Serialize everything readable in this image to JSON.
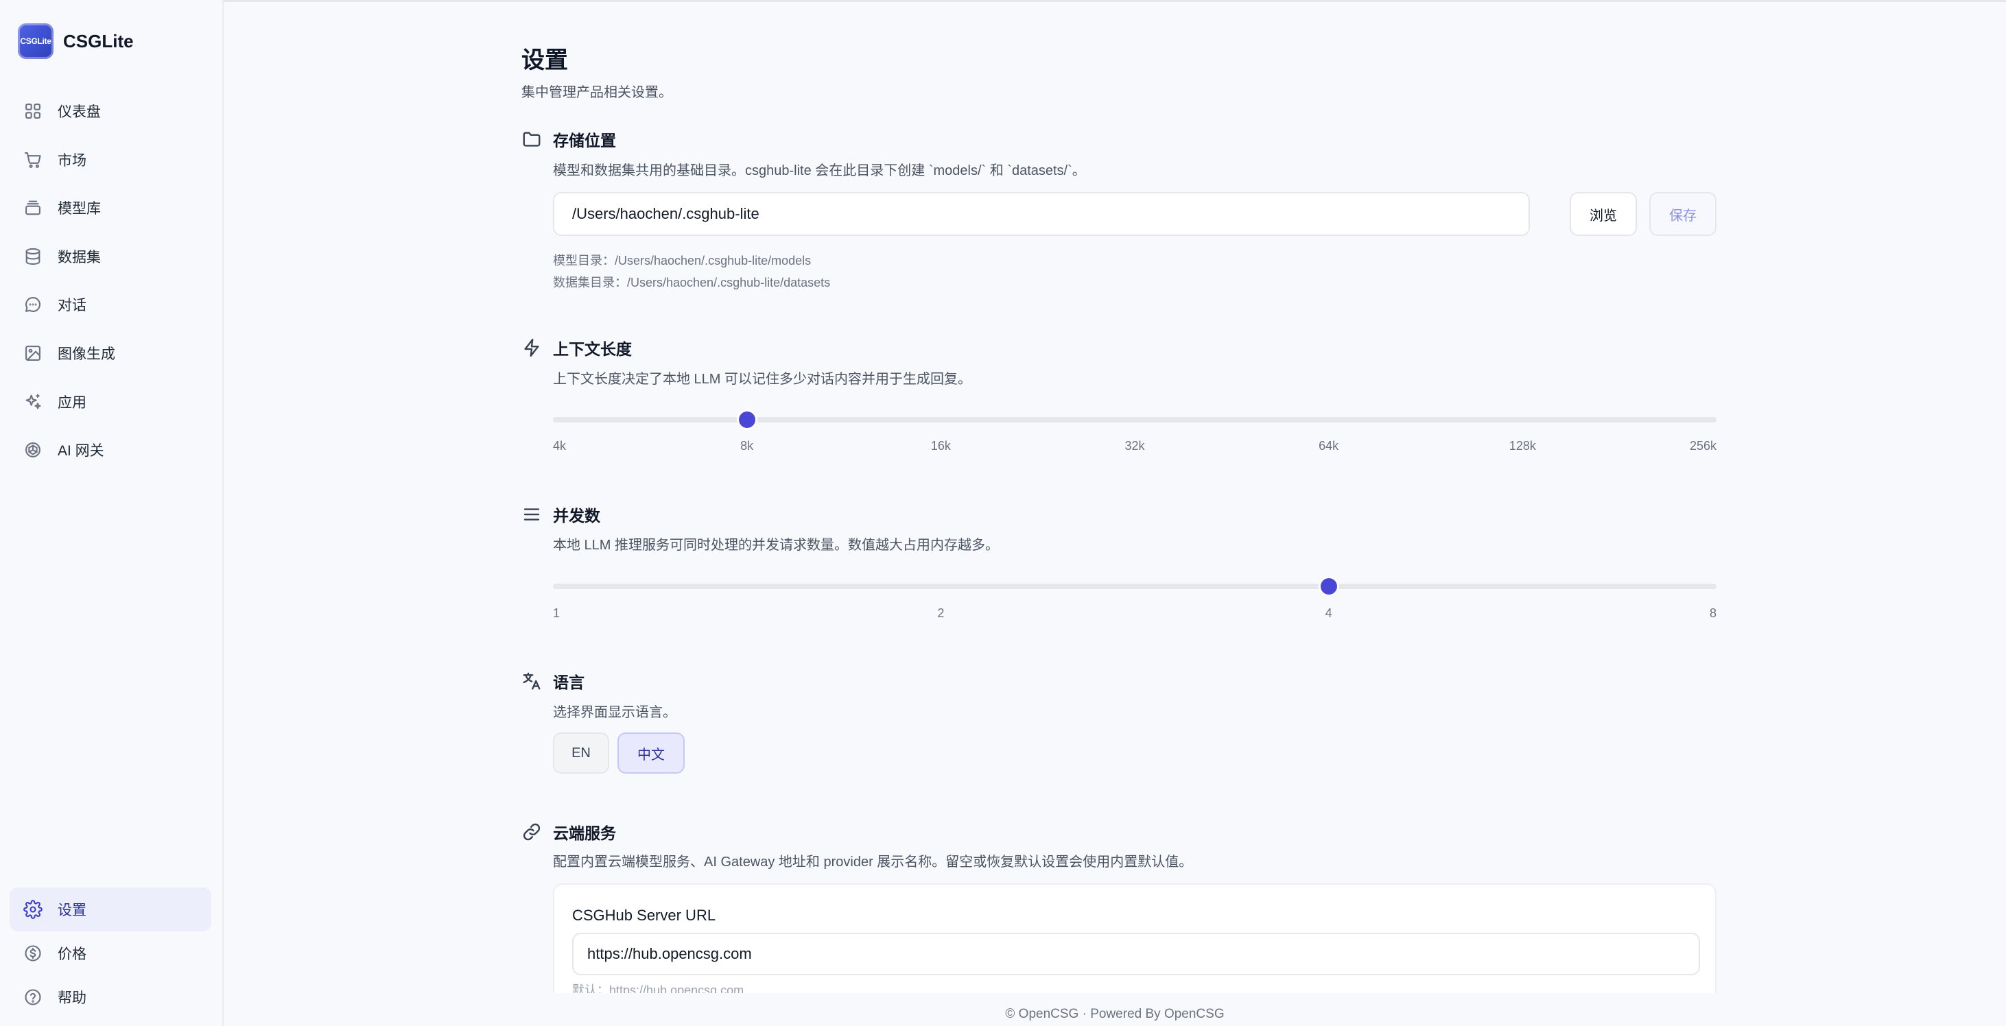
{
  "app": {
    "name": "CSGLite",
    "logo_text": "CSGLite"
  },
  "sidebar": {
    "items": [
      {
        "label": "仪表盘",
        "icon": "grid-icon"
      },
      {
        "label": "市场",
        "icon": "cart-icon"
      },
      {
        "label": "模型库",
        "icon": "layers-icon"
      },
      {
        "label": "数据集",
        "icon": "database-icon"
      },
      {
        "label": "对话",
        "icon": "chat-icon"
      },
      {
        "label": "图像生成",
        "icon": "image-icon"
      },
      {
        "label": "应用",
        "icon": "sparkles-icon"
      },
      {
        "label": "AI 网关",
        "icon": "openai-icon"
      }
    ],
    "bottom_items": [
      {
        "label": "设置",
        "icon": "gear-icon",
        "active": true
      },
      {
        "label": "价格",
        "icon": "dollar-icon"
      },
      {
        "label": "帮助",
        "icon": "help-icon"
      }
    ]
  },
  "page": {
    "title": "设置",
    "subtitle": "集中管理产品相关设置。"
  },
  "storage": {
    "title": "存储位置",
    "desc": "模型和数据集共用的基础目录。csghub-lite 会在此目录下创建 `models/` 和 `datasets/`。",
    "path_value": "/Users/haochen/.csghub-lite",
    "browse_label": "浏览",
    "save_label": "保存",
    "models_dir": "模型目录：/Users/haochen/.csghub-lite/models",
    "datasets_dir": "数据集目录：/Users/haochen/.csghub-lite/datasets"
  },
  "context": {
    "title": "上下文长度",
    "desc": "上下文长度决定了本地 LLM 可以记住多少对话内容并用于生成回复。",
    "ticks": [
      "4k",
      "8k",
      "16k",
      "32k",
      "64k",
      "128k",
      "256k"
    ],
    "value": "8k",
    "value_index": 1
  },
  "concurrency": {
    "title": "并发数",
    "desc": "本地 LLM 推理服务可同时处理的并发请求数量。数值越大占用内存越多。",
    "ticks": [
      "1",
      "2",
      "4",
      "8"
    ],
    "value": "4",
    "value_index": 2
  },
  "language": {
    "title": "语言",
    "desc": "选择界面显示语言。",
    "options": [
      "EN",
      "中文"
    ],
    "selected": "中文"
  },
  "cloud": {
    "title": "云端服务",
    "desc": "配置内置云端模型服务、AI Gateway 地址和 provider 展示名称。留空或恢复默认设置会使用内置默认值。",
    "server_url_label": "CSGHub Server URL",
    "server_url_value": "https://hub.opencsg.com",
    "server_url_default": "默认：https://hub.opencsg.com"
  },
  "footer": {
    "text": "© OpenCSG · Powered By OpenCSG"
  },
  "colors": {
    "accent": "#4a47d6",
    "active_bg": "#eceefc"
  }
}
